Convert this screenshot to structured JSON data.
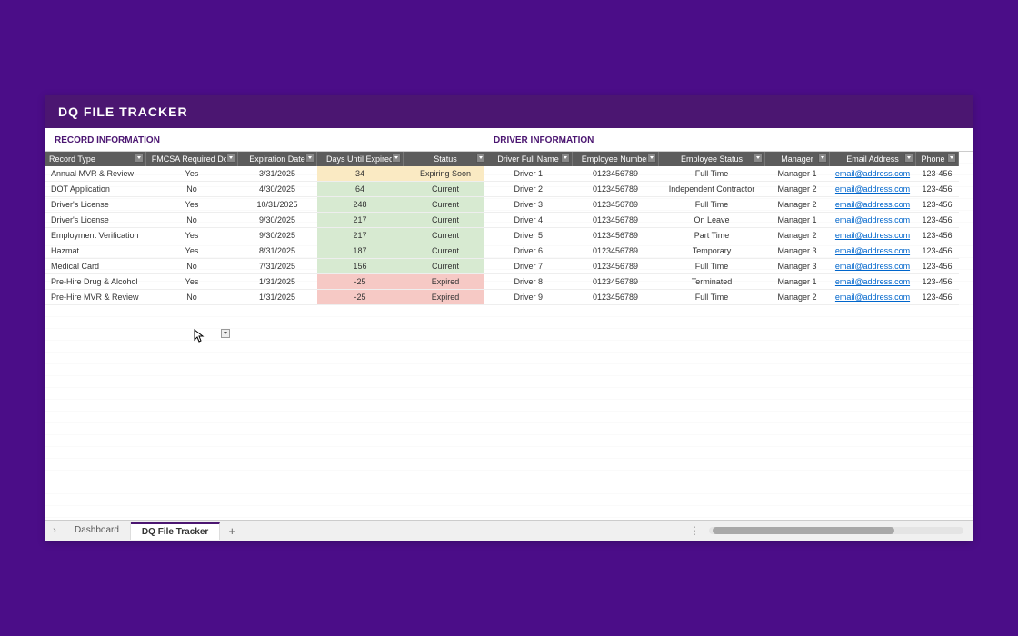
{
  "window_title": "DQ FILE TRACKER",
  "sections": {
    "left_label": "RECORD INFORMATION",
    "right_label": "DRIVER INFORMATION"
  },
  "left_columns": [
    {
      "label": "Record Type",
      "width": 110,
      "align": "left"
    },
    {
      "label": "FMCSA Required Doc",
      "width": 100,
      "align": "center"
    },
    {
      "label": "Expiration Date",
      "width": 86,
      "align": "center"
    },
    {
      "label": "Days Until Expired",
      "width": 94,
      "align": "center"
    },
    {
      "label": "Status",
      "width": 92,
      "align": "center"
    }
  ],
  "right_columns": [
    {
      "label": "Driver Full Name",
      "width": 96,
      "align": "center"
    },
    {
      "label": "Employee Number",
      "width": 94,
      "align": "center"
    },
    {
      "label": "Employee Status",
      "width": 116,
      "align": "center"
    },
    {
      "label": "Manager",
      "width": 70,
      "align": "center"
    },
    {
      "label": "Email Address",
      "width": 94,
      "align": "center",
      "link": true
    },
    {
      "label": "Phone N",
      "width": 46,
      "align": "center"
    }
  ],
  "left_rows": [
    {
      "record_type": "Annual MVR & Review",
      "fmcsa": "Yes",
      "exp": "3/31/2025",
      "days": "34",
      "status": "Expiring Soon",
      "status_class": "expiring"
    },
    {
      "record_type": "DOT Application",
      "fmcsa": "No",
      "exp": "4/30/2025",
      "days": "64",
      "status": "Current",
      "status_class": "current"
    },
    {
      "record_type": "Driver's License",
      "fmcsa": "Yes",
      "exp": "10/31/2025",
      "days": "248",
      "status": "Current",
      "status_class": "current"
    },
    {
      "record_type": "Driver's License",
      "fmcsa": "No",
      "exp": "9/30/2025",
      "days": "217",
      "status": "Current",
      "status_class": "current"
    },
    {
      "record_type": "Employment Verification",
      "fmcsa": "Yes",
      "exp": "9/30/2025",
      "days": "217",
      "status": "Current",
      "status_class": "current"
    },
    {
      "record_type": "Hazmat",
      "fmcsa": "Yes",
      "exp": "8/31/2025",
      "days": "187",
      "status": "Current",
      "status_class": "current"
    },
    {
      "record_type": "Medical Card",
      "fmcsa": "No",
      "exp": "7/31/2025",
      "days": "156",
      "status": "Current",
      "status_class": "current"
    },
    {
      "record_type": "Pre-Hire Drug & Alcohol",
      "fmcsa": "Yes",
      "exp": "1/31/2025",
      "days": "-25",
      "status": "Expired",
      "status_class": "expired"
    },
    {
      "record_type": "Pre-Hire MVR & Review",
      "fmcsa": "No",
      "exp": "1/31/2025",
      "days": "-25",
      "status": "Expired",
      "status_class": "expired"
    }
  ],
  "right_rows": [
    {
      "name": "Driver 1",
      "emp_no": "0123456789",
      "emp_status": "Full Time",
      "manager": "Manager 1",
      "email": "email@address.com",
      "phone": "123-456"
    },
    {
      "name": "Driver 2",
      "emp_no": "0123456789",
      "emp_status": "Independent Contractor",
      "manager": "Manager 2",
      "email": "email@address.com",
      "phone": "123-456"
    },
    {
      "name": "Driver 3",
      "emp_no": "0123456789",
      "emp_status": "Full Time",
      "manager": "Manager 2",
      "email": "email@address.com",
      "phone": "123-456"
    },
    {
      "name": "Driver 4",
      "emp_no": "0123456789",
      "emp_status": "On Leave",
      "manager": "Manager 1",
      "email": "email@address.com",
      "phone": "123-456"
    },
    {
      "name": "Driver 5",
      "emp_no": "0123456789",
      "emp_status": "Part Time",
      "manager": "Manager 2",
      "email": "email@address.com",
      "phone": "123-456"
    },
    {
      "name": "Driver 6",
      "emp_no": "0123456789",
      "emp_status": "Temporary",
      "manager": "Manager 3",
      "email": "email@address.com",
      "phone": "123-456"
    },
    {
      "name": "Driver 7",
      "emp_no": "0123456789",
      "emp_status": "Full Time",
      "manager": "Manager 3",
      "email": "email@address.com",
      "phone": "123-456"
    },
    {
      "name": "Driver 8",
      "emp_no": "0123456789",
      "emp_status": "Terminated",
      "manager": "Manager 1",
      "email": "email@address.com",
      "phone": "123-456"
    },
    {
      "name": "Driver 9",
      "emp_no": "0123456789",
      "emp_status": "Full Time",
      "manager": "Manager 2",
      "email": "email@address.com",
      "phone": "123-456"
    }
  ],
  "sheet_tabs": {
    "prev_icon": "›",
    "tabs": [
      {
        "label": "Dashboard",
        "active": false
      },
      {
        "label": "DQ File Tracker",
        "active": true
      }
    ],
    "add_label": "+",
    "more_label": "⋮"
  }
}
